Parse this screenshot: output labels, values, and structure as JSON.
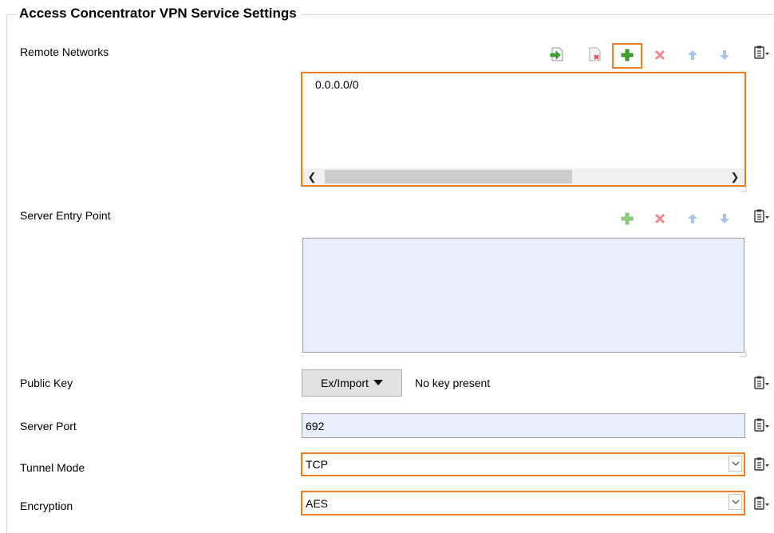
{
  "section": {
    "title": "Access Concentrator VPN Service Settings"
  },
  "remote_networks": {
    "label": "Remote Networks",
    "items": [
      "0.0.0.0/0"
    ],
    "toolbar": [
      "import-icon",
      "clear-list-icon",
      "add-icon",
      "delete-icon",
      "move-up-icon",
      "move-down-icon"
    ]
  },
  "server_entry_point": {
    "label": "Server Entry Point",
    "items": [],
    "toolbar": [
      "add-icon",
      "delete-icon",
      "move-up-icon",
      "move-down-icon"
    ]
  },
  "public_key": {
    "label": "Public Key",
    "button_label": "Ex/Import",
    "status": "No key present"
  },
  "server_port": {
    "label": "Server Port",
    "value": "692"
  },
  "tunnel_mode": {
    "label": "Tunnel Mode",
    "value": "TCP"
  },
  "encryption": {
    "label": "Encryption",
    "value": "AES"
  },
  "colors": {
    "highlight": "#ef7d22",
    "field_bg": "#e8f1fb",
    "add_green": "#3aa52b",
    "delete_red": "#e8474a",
    "arrow_blue": "#8fb4e3"
  }
}
